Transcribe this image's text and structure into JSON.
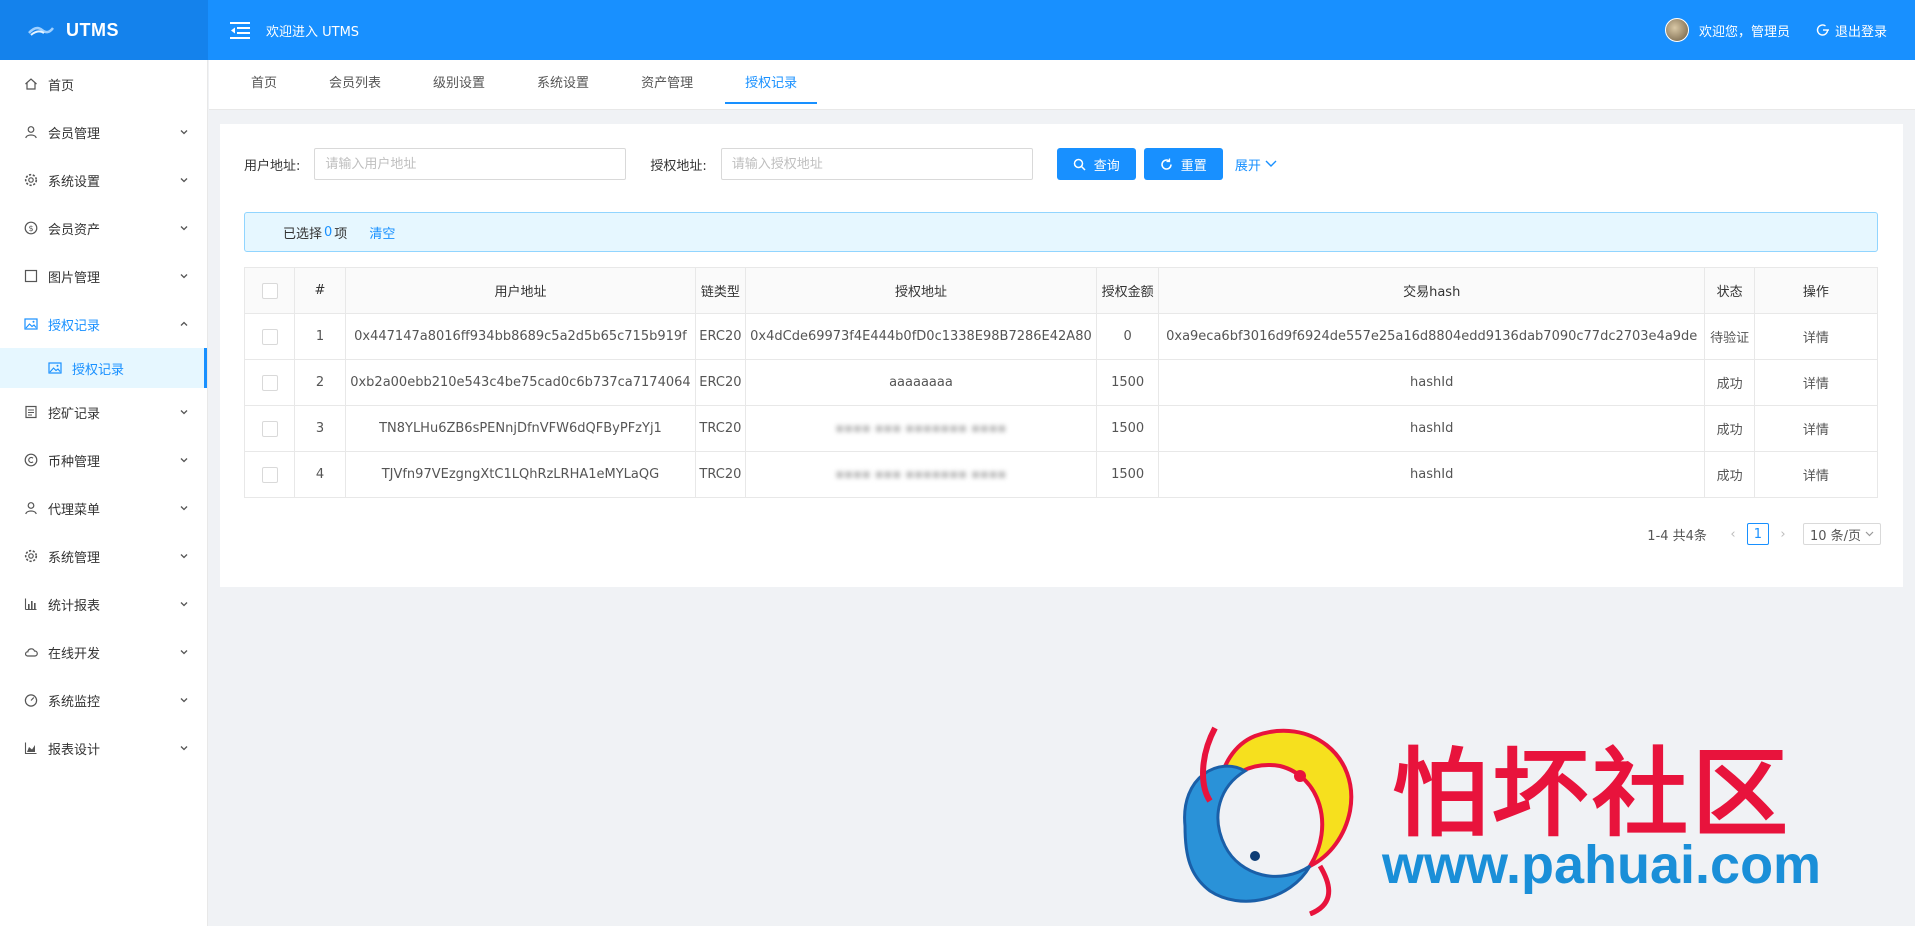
{
  "app": {
    "logo_text": "UTMS",
    "welcome": "欢迎进入 UTMS"
  },
  "header": {
    "user_greeting": "欢迎您，管理员",
    "logout": "退出登录"
  },
  "sidebar": {
    "items": [
      {
        "label": "首页",
        "icon": "home-icon"
      },
      {
        "label": "会员管理",
        "icon": "user-icon"
      },
      {
        "label": "系统设置",
        "icon": "gear-icon"
      },
      {
        "label": "会员资产",
        "icon": "dollar-icon"
      },
      {
        "label": "图片管理",
        "icon": "square-icon"
      },
      {
        "label": "授权记录",
        "icon": "picture-icon",
        "open": true
      },
      {
        "label": "挖矿记录",
        "icon": "list-icon"
      },
      {
        "label": "币种管理",
        "icon": "copyright-icon"
      },
      {
        "label": "代理菜单",
        "icon": "user-icon"
      },
      {
        "label": "系统管理",
        "icon": "gear-icon"
      },
      {
        "label": "统计报表",
        "icon": "bar-chart-icon"
      },
      {
        "label": "在线开发",
        "icon": "cloud-icon"
      },
      {
        "label": "系统监控",
        "icon": "dashboard-icon"
      },
      {
        "label": "报表设计",
        "icon": "area-chart-icon"
      }
    ],
    "sub_item": "授权记录"
  },
  "tabs": [
    "首页",
    "会员列表",
    "级别设置",
    "系统设置",
    "资产管理",
    "授权记录"
  ],
  "active_tab": "授权记录",
  "search": {
    "user_label": "用户地址:",
    "user_placeholder": "请输入用户地址",
    "auth_label": "授权地址:",
    "auth_placeholder": "请输入授权地址",
    "query": "查询",
    "reset": "重置",
    "expand": "展开"
  },
  "alert": {
    "selected_prefix": "已选择",
    "selected_count": "0",
    "selected_suffix": "项",
    "clear": "清空"
  },
  "table": {
    "headers": [
      "#",
      "用户地址",
      "链类型",
      "授权地址",
      "授权金额",
      "交易hash",
      "状态",
      "操作"
    ],
    "rows": [
      {
        "no": "1",
        "user": "0x447147a8016ff934bb8689c5a2d5b65c715b919f",
        "chain": "ERC20",
        "auth": "0x4dCde69973f4E444b0fD0c1338E98B7286E42A80",
        "amount": "0",
        "hash": "0xa9eca6bf3016d9f6924de557e25a16d8804edd9136dab7090c77dc2703e4a9de",
        "status": "待验证",
        "action": "详情"
      },
      {
        "no": "2",
        "user": "0xb2a00ebb210e543c4be75cad0c6b737ca7174064",
        "chain": "ERC20",
        "auth": "aaaaaaaa",
        "amount": "1500",
        "hash": "hashId",
        "status": "成功",
        "action": "详情"
      },
      {
        "no": "3",
        "user": "TN8YLHu6ZB6sPENnjDfnVFW6dQFByPFzYj1",
        "chain": "TRC20",
        "auth": "",
        "amount": "1500",
        "hash": "hashId",
        "status": "成功",
        "action": "详情"
      },
      {
        "no": "4",
        "user": "TJVfn97VEzgngXtC1LQhRzLRHA1eMYLaQG",
        "chain": "TRC20",
        "auth": "",
        "amount": "1500",
        "hash": "hashId",
        "status": "成功",
        "action": "详情"
      }
    ]
  },
  "pagination": {
    "total": "1-4 共4条",
    "current": "1",
    "page_size": "10 条/页"
  },
  "watermark": {
    "title": "怕坏社区",
    "url": "www.pahuai.com"
  },
  "colors": {
    "primary": "#1890ff",
    "header_bg": "#1890ff",
    "watermark_red": "#e8133c",
    "watermark_blue": "#1a8fd8"
  }
}
